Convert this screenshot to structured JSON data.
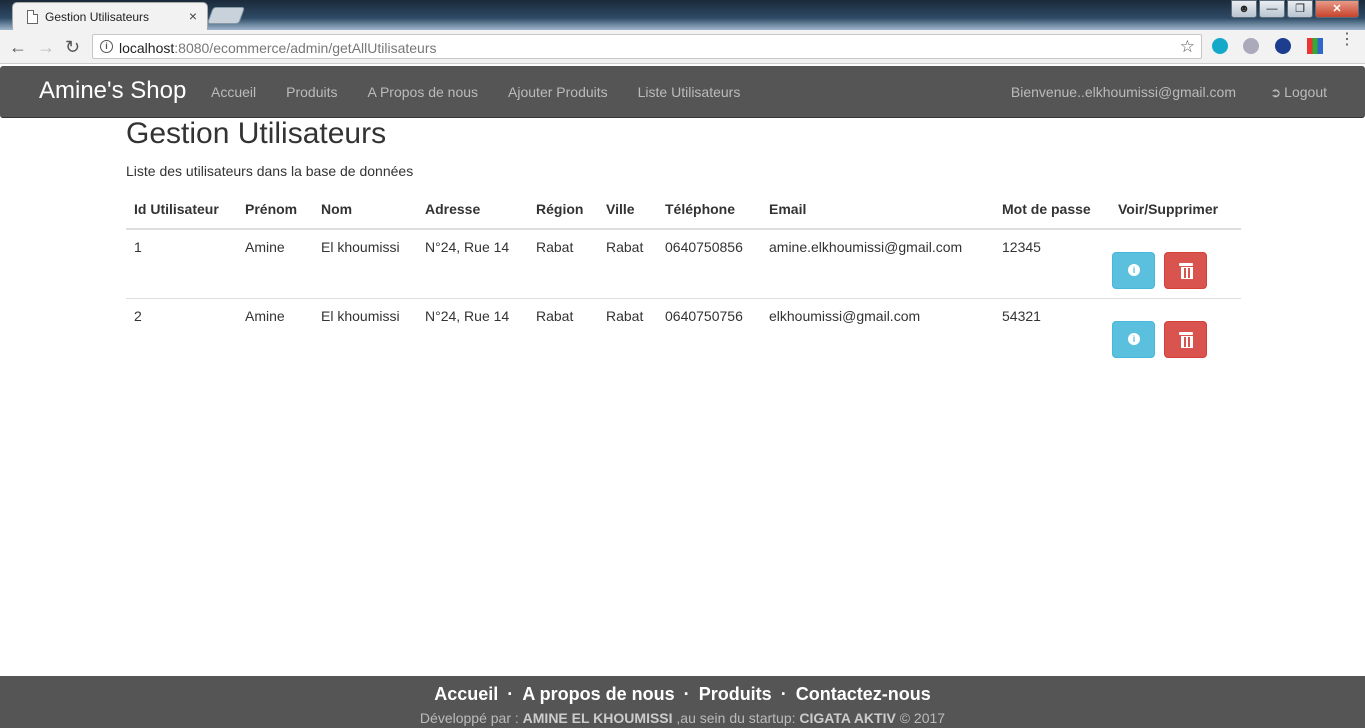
{
  "browser": {
    "tab_title": "Gestion Utilisateurs",
    "tab_close": "×",
    "url_host": "localhost",
    "url_rest": ":8080/ecommerce/admin/getAllUtilisateurs",
    "window_buttons": [
      "—",
      "❐",
      "✕"
    ]
  },
  "navbar": {
    "brand": "Amine's Shop",
    "links": [
      "Accueil",
      "Produits",
      "A Propos de nous",
      "Ajouter Produits",
      "Liste Utilisateurs"
    ],
    "welcome": "Bienvenue..elkhoumissi@gmail.com",
    "logout": "Logout"
  },
  "main": {
    "title": "Gestion Utilisateurs",
    "subtitle": "Liste des utilisateurs dans la base de données"
  },
  "table": {
    "headers": [
      "Id Utilisateur",
      "Prénom",
      "Nom",
      "Adresse",
      "Région",
      "Ville",
      "Téléphone",
      "Email",
      "Mot de passe",
      "Voir/Supprimer"
    ],
    "rows": [
      [
        "1",
        "Amine",
        "El khoumissi",
        "N°24, Rue 14",
        "Rabat",
        "Rabat",
        "0640750856",
        "amine.elkhoumissi@gmail.com",
        "12345"
      ],
      [
        "2",
        "Amine",
        "El khoumissi",
        "N°24, Rue 14",
        "Rabat",
        "Rabat",
        "0640750756",
        "elkhoumissi@gmail.com",
        "54321"
      ]
    ]
  },
  "footer": {
    "links": [
      "Accueil",
      "A propos de nous",
      "Produits",
      "Contactez-nous"
    ],
    "separator": "·",
    "credits_prefix": "Développé par :",
    "credits_author": "AMINE EL KHOUMISSI",
    "credits_middle": ",au sein du startup:",
    "credits_company": "CIGATA AKTIV",
    "credits_suffix": "© 2017"
  },
  "colors": {
    "navbar_bg": "#555555",
    "btn_info": "#5bc0de",
    "btn_danger": "#d9534f"
  }
}
